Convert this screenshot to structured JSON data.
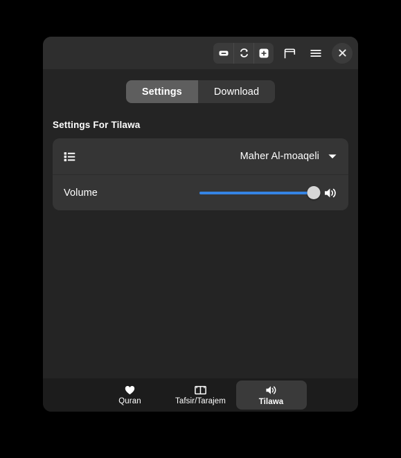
{
  "window": {
    "headerbar": {
      "buttons": [
        {
          "name": "zoom-out-button",
          "icon": "minus-square-icon",
          "label": "Zoom out"
        },
        {
          "name": "zoom-reset-button",
          "icon": "refresh-loop-icon",
          "label": "Reset zoom"
        },
        {
          "name": "zoom-in-button",
          "icon": "plus-square-icon",
          "label": "Zoom in"
        },
        {
          "name": "window-toggle-button",
          "icon": "window-icon",
          "label": "Toggle window"
        },
        {
          "name": "menu-button",
          "icon": "hamburger-menu-icon",
          "label": "Main menu"
        },
        {
          "name": "close-button",
          "icon": "close-x-icon",
          "label": "Close"
        }
      ]
    },
    "tabs": [
      {
        "label": "Settings",
        "active": true
      },
      {
        "label": "Download",
        "active": false
      }
    ],
    "section": {
      "title": "Settings For Tilawa"
    },
    "settings": {
      "reciter": {
        "icon": "list-bullet-icon",
        "value": "Maher Al-moaqeli",
        "chevron": "chevron-down-icon"
      },
      "volume": {
        "label": "Volume",
        "value": 100,
        "min": 0,
        "max": 100,
        "icon": "speaker-volume-icon",
        "accent_color": "#3584e4"
      }
    },
    "bottom_nav": [
      {
        "label": "Quran",
        "icon": "heart-icon",
        "active": false
      },
      {
        "label": "Tafsir/Tarajem",
        "icon": "open-book-icon",
        "active": false
      },
      {
        "label": "Tilawa",
        "icon": "speaker-volume-icon",
        "active": true
      }
    ]
  },
  "colors": {
    "window_bg": "#242424",
    "header_bg": "#2e2e2e",
    "card_bg": "#353535",
    "nav_bg": "#1c1c1c",
    "accent": "#3584e4",
    "tab_active": "#5e5e5e",
    "tab_inactive": "#383838"
  }
}
